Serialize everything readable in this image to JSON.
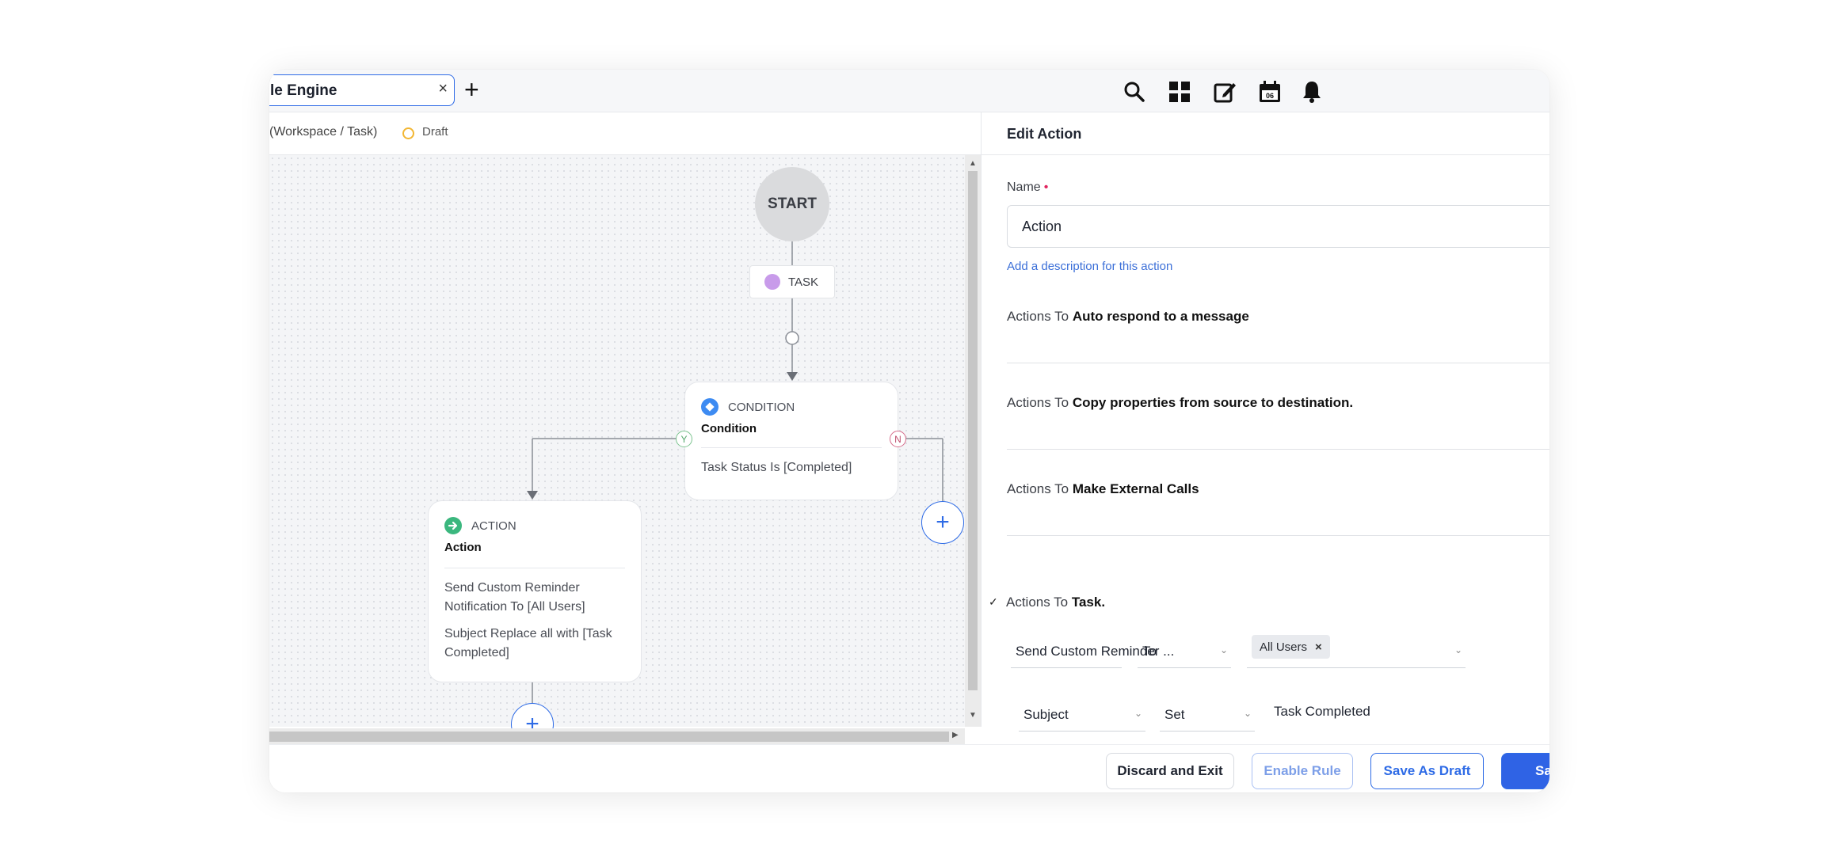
{
  "tab": {
    "title": "le Engine",
    "close": "×",
    "add": "+"
  },
  "header_icons": [
    "search-icon",
    "grid-icon",
    "edit-icon",
    "calendar-icon",
    "bell-icon"
  ],
  "calendar_day": "06",
  "canvas": {
    "breadcrumb": "(Workspace / Task)",
    "status": "Draft"
  },
  "flow": {
    "start": "START",
    "task": "TASK",
    "condition": {
      "type": "CONDITION",
      "name": "Condition",
      "body": "Task Status Is [Completed]",
      "yes": "Y",
      "no": "N"
    },
    "action": {
      "type": "ACTION",
      "name": "Action",
      "line1": "Send Custom Reminder Notification To [All Users]",
      "line2": "Subject Replace all with [Task Completed]"
    },
    "plus": "+"
  },
  "panel": {
    "title": "Edit Action",
    "name_label": "Name",
    "required_mark": "•",
    "name_value": "Action",
    "desc_link": "Add a description for this action",
    "action_prefix": "Actions To",
    "actions": [
      "Auto respond to a message",
      "Copy properties from source to destination.",
      "Make External Calls",
      "Task."
    ],
    "selected_check": "✓",
    "row1": {
      "action": "Send Custom Reminder ...",
      "to": "To",
      "chip": "All Users",
      "chip_x": "×"
    },
    "row2": {
      "field": "Subject",
      "op": "Set",
      "value": "Task Completed"
    }
  },
  "footer": {
    "discard": "Discard and Exit",
    "enable": "Enable Rule",
    "save_draft": "Save As Draft",
    "save": "Sa"
  },
  "colors": {
    "accent": "#2e6be6",
    "draft": "#f2b632",
    "condition": "#3d8bf2",
    "action": "#3bb77e",
    "task": "#c89bea"
  }
}
